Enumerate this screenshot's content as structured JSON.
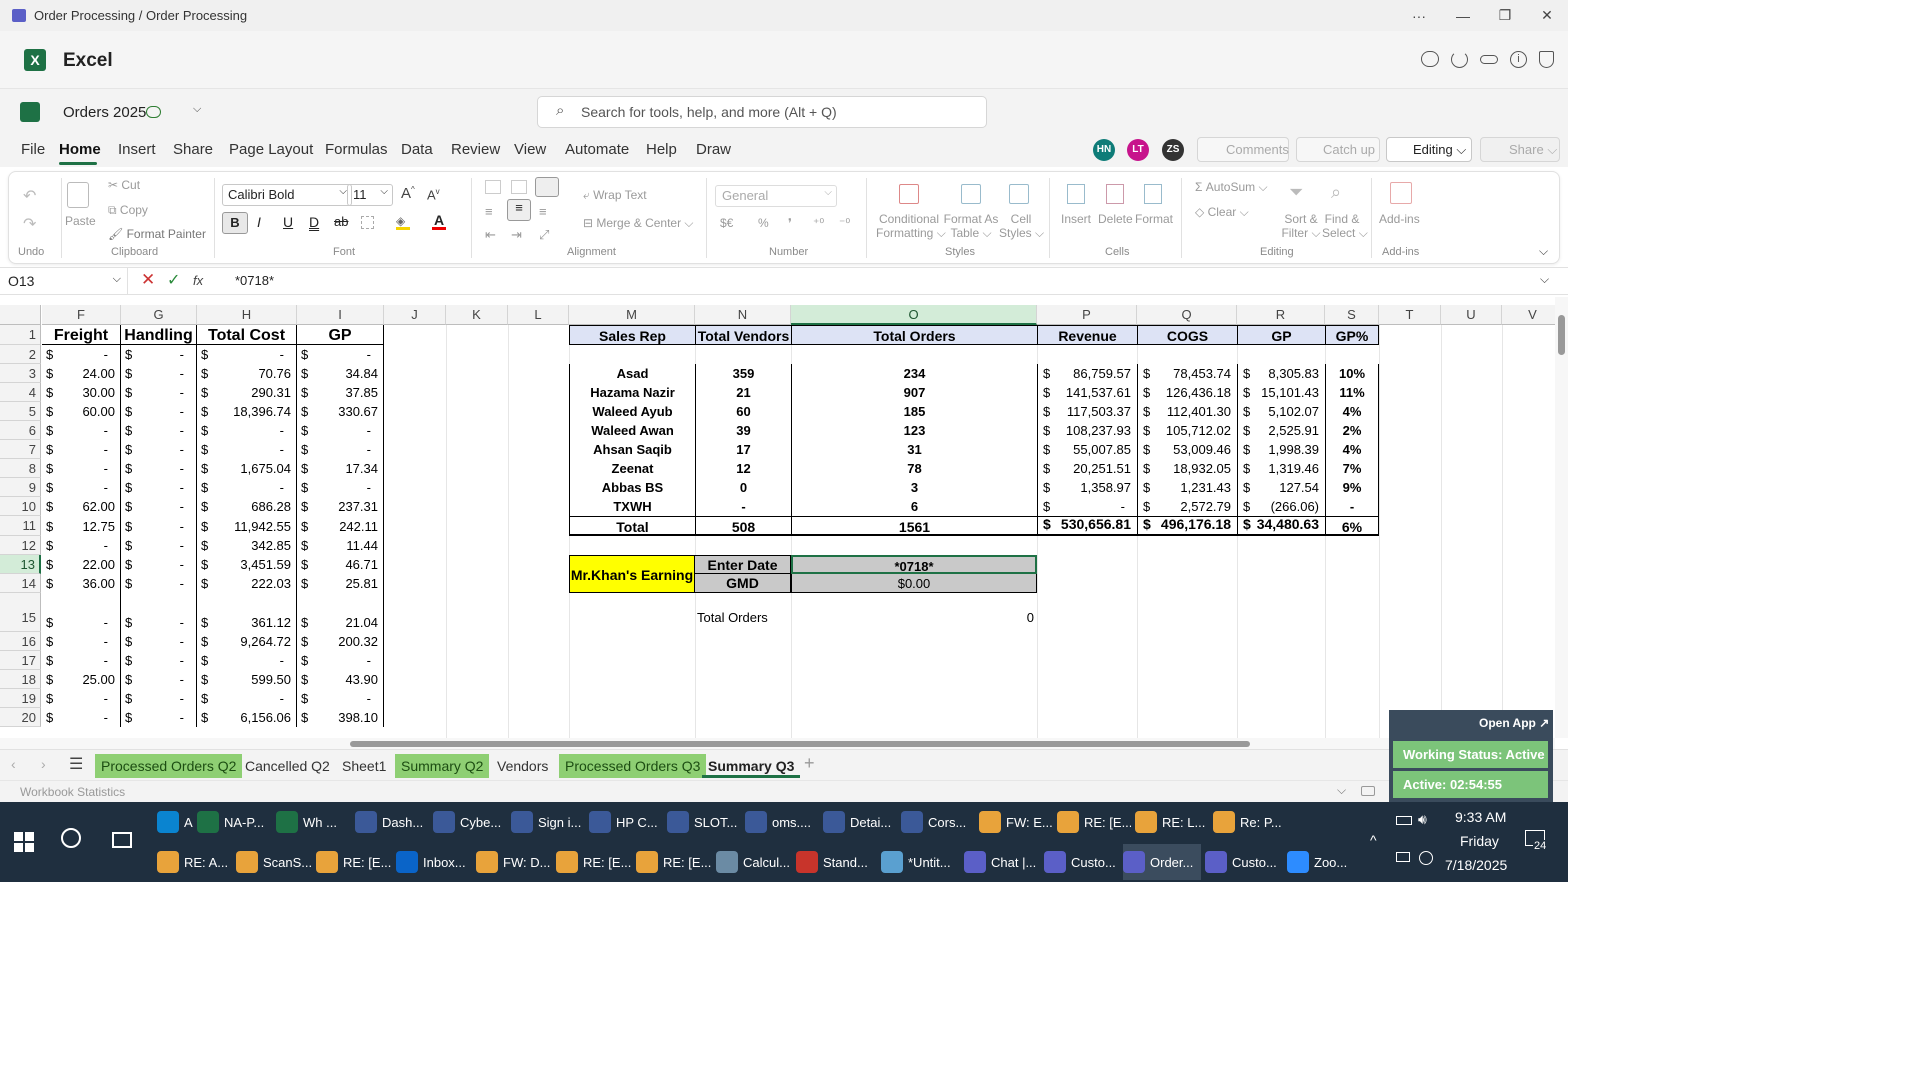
{
  "window": {
    "title": "Order Processing / Order Processing",
    "more": "···",
    "min": "—",
    "max": "❐",
    "close": "✕"
  },
  "app": {
    "name": "Excel"
  },
  "doc": {
    "name": "Orders 2025",
    "search_placeholder": "Search for tools, help, and more (Alt + Q)"
  },
  "users": [
    "HN",
    "LT",
    "ZS"
  ],
  "top_buttons": {
    "comments": "Comments",
    "catchup": "Catch up",
    "editing": "Editing",
    "share": "Share"
  },
  "tabs": [
    "File",
    "Home",
    "Insert",
    "Share",
    "Page Layout",
    "Formulas",
    "Data",
    "Review",
    "View",
    "Automate",
    "Help",
    "Draw"
  ],
  "ribbon": {
    "undo_group": "Undo",
    "clipboard": {
      "paste": "Paste",
      "cut": "Cut",
      "copy": "Copy",
      "format_painter": "Format Painter",
      "label": "Clipboard"
    },
    "font": {
      "name": "Calibri Bold",
      "size": "11",
      "label": "Font",
      "bold": "B",
      "italic": "I",
      "underline": "U",
      "dbl": "D",
      "strike": "ab"
    },
    "alignment": {
      "wrap": "Wrap Text",
      "merge": "Merge & Center",
      "label": "Alignment"
    },
    "number": {
      "format": "General",
      "label": "Number",
      "currency": "$€",
      "percent": "%",
      "comma": "❜"
    },
    "styles": {
      "cond1": "Conditional",
      "cond2": "Formatting",
      "fat1": "Format As",
      "fat2": "Table",
      "cs1": "Cell",
      "cs2": "Styles",
      "label": "Styles"
    },
    "cells": {
      "insert": "Insert",
      "delete": "Delete",
      "format": "Format",
      "label": "Cells"
    },
    "editing": {
      "autosum": "AutoSum",
      "clear": "Clear",
      "sort1": "Sort &",
      "sort2": "Filter",
      "find1": "Find &",
      "find2": "Select",
      "label": "Editing"
    },
    "addins": {
      "name": "Add-ins",
      "label": "Add-ins"
    }
  },
  "formula_bar": {
    "name_box": "O13",
    "fx": "fx",
    "formula": "*0718*"
  },
  "columns": [
    "F",
    "G",
    "H",
    "I",
    "J",
    "K",
    "L",
    "M",
    "N",
    "O",
    "P",
    "Q",
    "R",
    "S",
    "T",
    "U",
    "V"
  ],
  "rows": [
    "1",
    "2",
    "3",
    "4",
    "5",
    "6",
    "7",
    "8",
    "9",
    "10",
    "11",
    "12",
    "13",
    "14",
    "15",
    "16",
    "17",
    "18",
    "19",
    "20"
  ],
  "left_headers": [
    "Freight",
    "Handling",
    "Total Cost",
    "GP"
  ],
  "left_data": [
    [
      "-",
      "-",
      "-",
      "-"
    ],
    [
      "24.00",
      "-",
      "70.76",
      "34.84"
    ],
    [
      "30.00",
      "-",
      "290.31",
      "37.85"
    ],
    [
      "60.00",
      "-",
      "18,396.74",
      "330.67"
    ],
    [
      "-",
      "-",
      "-",
      "-"
    ],
    [
      "-",
      "-",
      "-",
      "-"
    ],
    [
      "-",
      "-",
      "1,675.04",
      "17.34"
    ],
    [
      "-",
      "-",
      "-",
      "-"
    ],
    [
      "62.00",
      "-",
      "686.28",
      "237.31"
    ],
    [
      "12.75",
      "-",
      "11,942.55",
      "242.11"
    ],
    [
      "-",
      "-",
      "342.85",
      "11.44"
    ],
    [
      "22.00",
      "-",
      "3,451.59",
      "46.71"
    ],
    [
      "36.00",
      "-",
      "222.03",
      "25.81"
    ],
    [
      "-",
      "-",
      "361.12",
      "21.04"
    ],
    [
      "-",
      "-",
      "9,264.72",
      "200.32"
    ],
    [
      "-",
      "-",
      "-",
      "-"
    ],
    [
      "25.00",
      "-",
      "599.50",
      "43.90"
    ],
    [
      "-",
      "-",
      "-",
      "-"
    ],
    [
      "-",
      "-",
      "6,156.06",
      "398.10"
    ]
  ],
  "summary": {
    "headers": [
      "Sales Rep",
      "Total Vendors",
      "Total Orders",
      "Revenue",
      "COGS",
      "GP",
      "GP%"
    ],
    "rows": [
      [
        "Asad",
        "359",
        "234",
        "86,759.57",
        "78,453.74",
        "8,305.83",
        "10%"
      ],
      [
        "Hazama Nazir",
        "21",
        "907",
        "141,537.61",
        "126,436.18",
        "15,101.43",
        "11%"
      ],
      [
        "Waleed Ayub",
        "60",
        "185",
        "117,503.37",
        "112,401.30",
        "5,102.07",
        "4%"
      ],
      [
        "Waleed Awan",
        "39",
        "123",
        "108,237.93",
        "105,712.02",
        "2,525.91",
        "2%"
      ],
      [
        "Ahsan Saqib",
        "17",
        "31",
        "55,007.85",
        "53,009.46",
        "1,998.39",
        "4%"
      ],
      [
        "Zeenat",
        "12",
        "78",
        "20,251.51",
        "18,932.05",
        "1,319.46",
        "7%"
      ],
      [
        "Abbas BS",
        "0",
        "3",
        "1,358.97",
        "1,231.43",
        "127.54",
        "9%"
      ],
      [
        "TXWH",
        "-",
        "6",
        "-",
        "2,572.79",
        "(266.06)",
        "-"
      ]
    ],
    "total": [
      "Total",
      "508",
      "1561",
      "530,656.81",
      "496,176.18",
      "34,480.63",
      "6%"
    ]
  },
  "earning": {
    "title": "Mr.Khan's Earning",
    "enter_date": "Enter Date",
    "date_value": "*0718*",
    "gmd": "GMD",
    "gmd_value": "$0.00",
    "total_orders_label": "Total Orders",
    "total_orders_value": "0"
  },
  "sheets": [
    "Processed Orders Q2",
    "Cancelled Q2",
    "Sheet1",
    "Summary Q2",
    "Vendors",
    "Processed Orders Q3",
    "Summary Q3"
  ],
  "active_sheet": "Summary Q3",
  "status": {
    "left": "Workbook Statistics"
  },
  "overlay": {
    "open_app": "Open App ↗",
    "working": "Working Status: Active",
    "active": "Active: 02:54:55"
  },
  "taskbar": {
    "row1": [
      "Ama...",
      "NA-P...",
      "Wh ...",
      "Dash...",
      "Cybe...",
      "Sign i...",
      "HP C...",
      "SLOT...",
      "oms....",
      "Detai...",
      "Cors...",
      "FW: E...",
      "RE: [E...",
      "RE: L...",
      "Re: P..."
    ],
    "row2": [
      "RE: A...",
      "ScanS...",
      "RE: [E...",
      "Inbox...",
      "FW: D...",
      "RE: [E...",
      "RE: [E...",
      "Calcul...",
      "Stand...",
      "*Untit...",
      "Chat |...",
      "Custo...",
      "Order...",
      "Custo...",
      "Zoo..."
    ],
    "time": "9:33 AM",
    "day": "Friday",
    "date": "7/18/2025",
    "notif": "24"
  }
}
